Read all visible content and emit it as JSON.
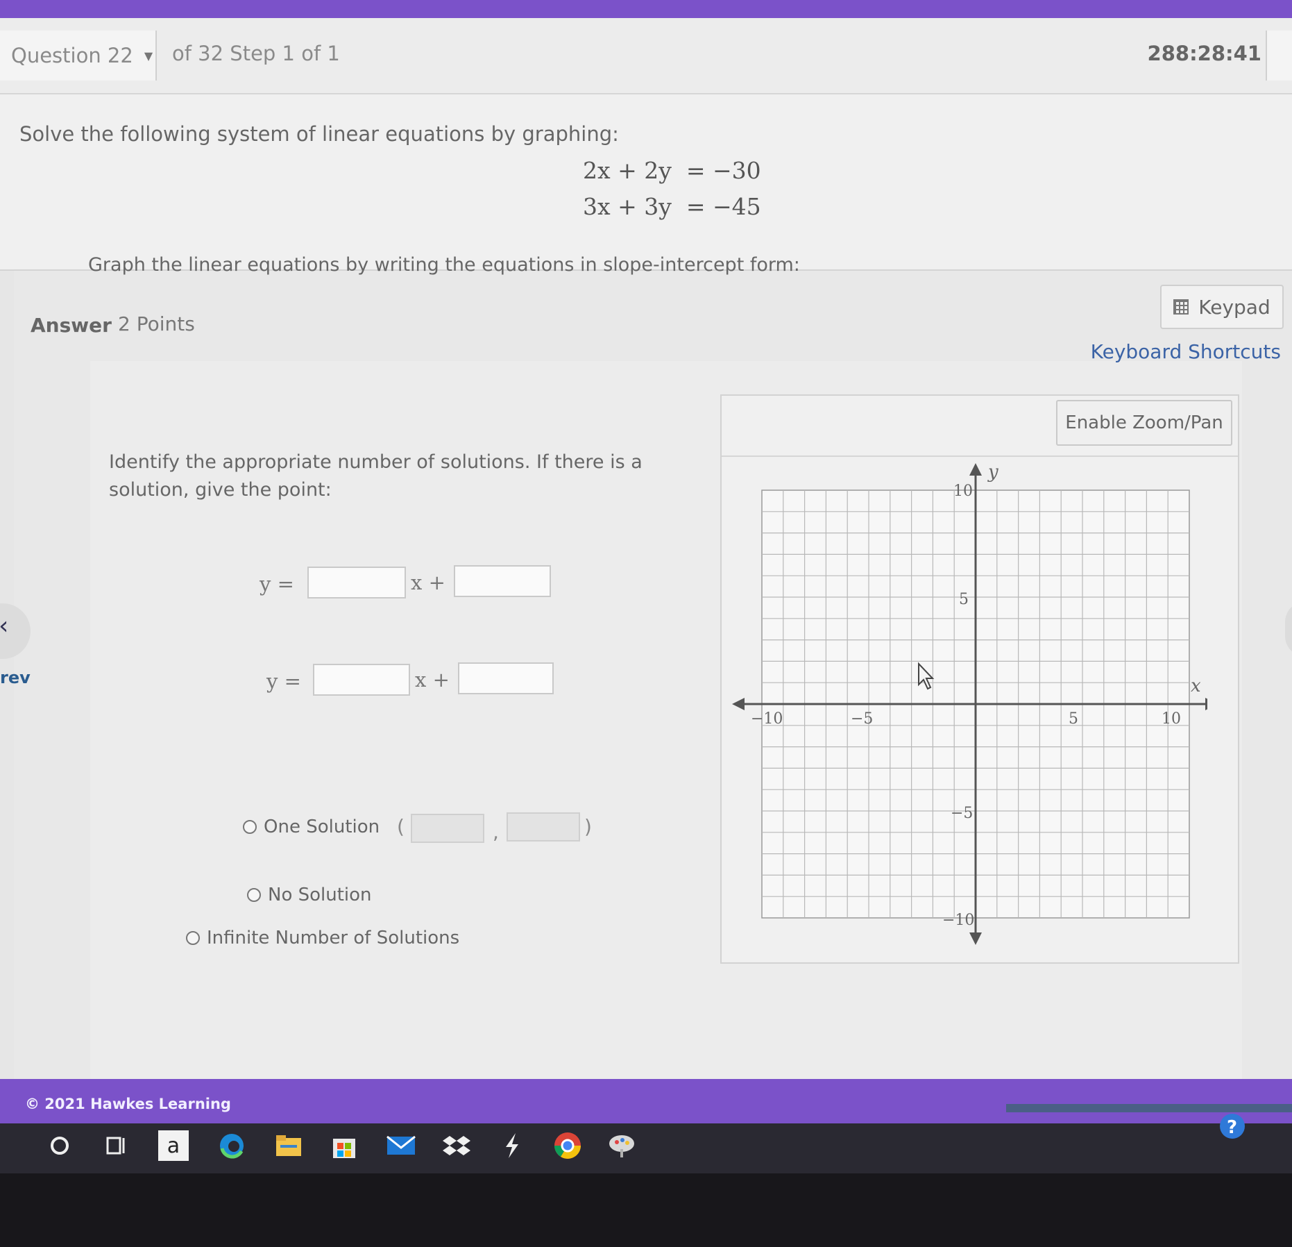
{
  "header": {
    "question_selector": "Question 22",
    "progress": "of 32 Step 1 of 1",
    "timer": "288:28:41"
  },
  "question": {
    "prompt": "Solve the following system of linear equations by graphing:",
    "equation_1": "2x + 2y  = −30",
    "equation_2": "3x + 3y  = −45"
  },
  "answer": {
    "label": "Answer",
    "points": "2 Points",
    "keypad_label": "Keypad",
    "shortcuts_label": "Keyboard Shortcuts",
    "instruction_slope": "Graph the linear equations by writing the equations in slope-intercept form:",
    "y_equals": "y =",
    "x_plus": "x +",
    "instruction_solutions": "Identify the appropriate number of solutions. If there is a solution, give the point:",
    "options": [
      "One Solution",
      "No Solution",
      "Infinite Number of Solutions"
    ],
    "paren_open": "(",
    "comma": ",",
    "paren_close": ")"
  },
  "graph": {
    "zoom_button": "Enable Zoom/Pan",
    "x_axis_label": "x",
    "y_axis_label": "y",
    "x_ticks": [
      "−10",
      "−5",
      "5",
      "10"
    ],
    "y_ticks": [
      "10",
      "5",
      "−5",
      "−10"
    ]
  },
  "nav": {
    "prev_label": "rev"
  },
  "footer": {
    "copyright": "© 2021 Hawkes Learning"
  },
  "taskbar": {
    "icons": [
      "cortana-icon",
      "task-view-icon",
      "amazon-icon",
      "edge-icon",
      "file-explorer-icon",
      "store-icon",
      "mail-icon",
      "dropbox-icon",
      "app-icon",
      "chrome-icon",
      "paint-icon",
      "help-icon"
    ]
  }
}
